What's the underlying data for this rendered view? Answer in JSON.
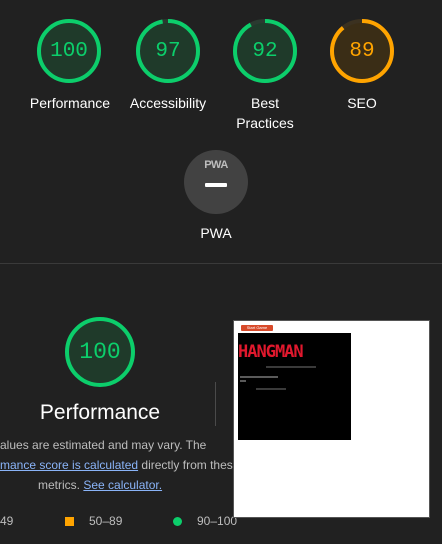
{
  "colors": {
    "pass": "#0cce6b",
    "average": "#ffa400",
    "pass_fill": "#1f3a2a",
    "average_fill": "#3a2d16",
    "pwa_fill": "#424242",
    "background": "#212121"
  },
  "categories": [
    {
      "score": "100",
      "label": "Performance",
      "color": "pass",
      "fraction": 1.0
    },
    {
      "score": "97",
      "label": "Accessibility",
      "color": "pass",
      "fraction": 0.97
    },
    {
      "score": "92",
      "label": "Best Practices",
      "label_line1": "Best",
      "label_line2": "Practices",
      "color": "pass",
      "fraction": 0.92
    },
    {
      "score": "89",
      "label": "SEO",
      "color": "average",
      "fraction": 0.89
    }
  ],
  "pwa": {
    "badge": "PWA",
    "label": "PWA",
    "icon": "pwa-dash-icon"
  },
  "performance": {
    "score": "100",
    "fraction": 1.0,
    "title": "Performance",
    "note_line1": "alues are estimated and may vary. The",
    "note_link": "mance score is calculated",
    "note_line2_rest": " directly from these",
    "note_line3_prefix": "metrics. ",
    "calc_link": "See calculator."
  },
  "legend": {
    "fail_range": "49",
    "average_range": "50–89",
    "pass_range": "90–100"
  },
  "screenshot": {
    "game_title": "HANGMAN",
    "button_label": "Start Game"
  }
}
